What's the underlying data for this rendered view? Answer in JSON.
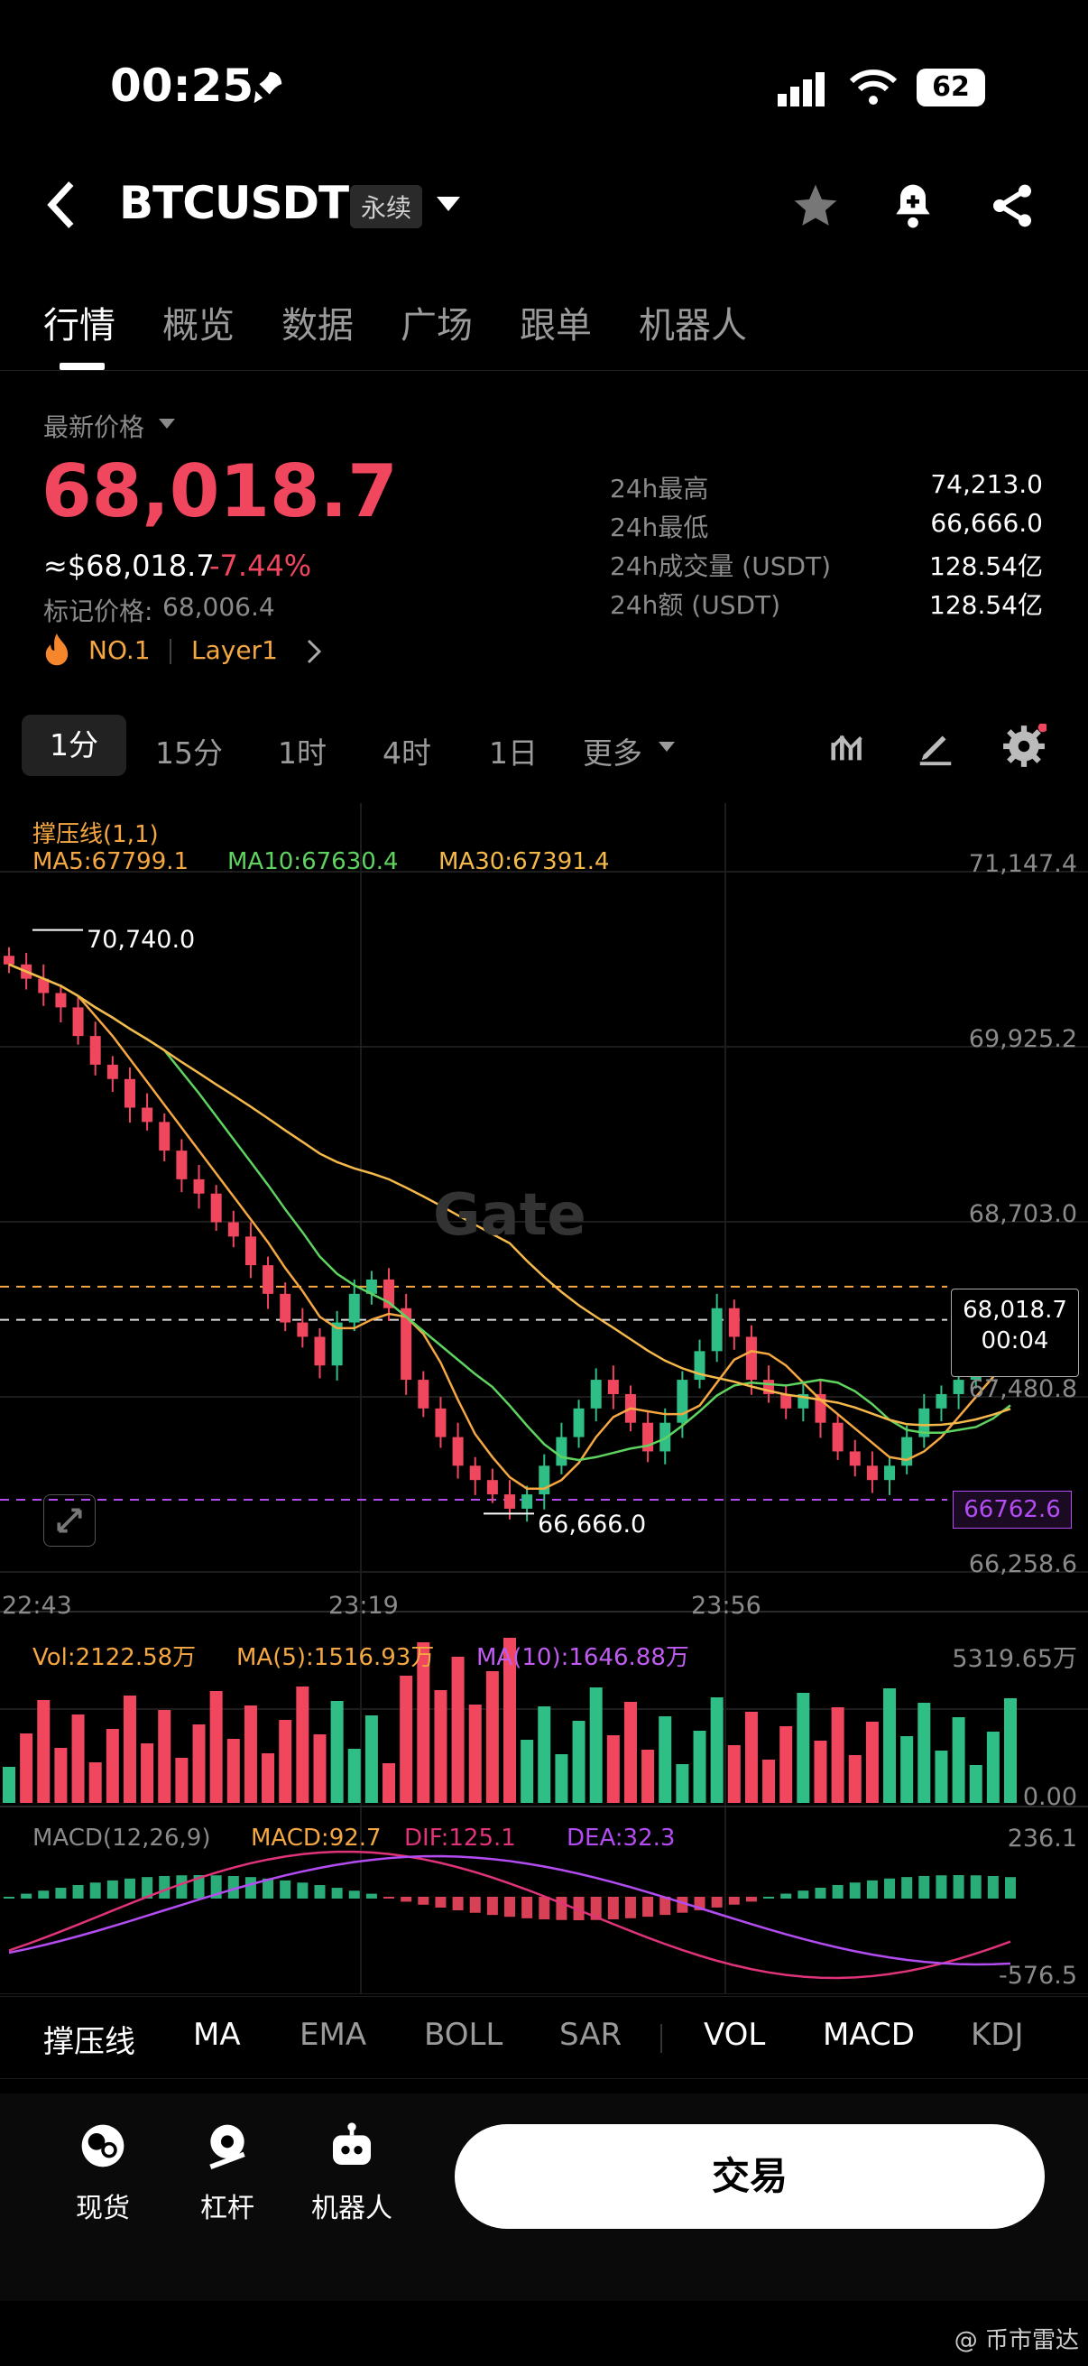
{
  "status_bar": {
    "time": "00:25",
    "battery": "62"
  },
  "header": {
    "symbol": "BTCUSDT",
    "contract_type": "永续"
  },
  "tabs": [
    "行情",
    "概览",
    "数据",
    "广场",
    "跟单",
    "机器人"
  ],
  "price": {
    "label": "最新价格",
    "last": "68,018.7",
    "usd": "≈$68,018.7",
    "change": "-7.44%",
    "mark_label": "标记价格:",
    "mark_value": "68,006.4",
    "rank": "NO.1",
    "category": "Layer1"
  },
  "stats": [
    {
      "label": "24h最高",
      "value": "74,213.0"
    },
    {
      "label": "24h最低",
      "value": "66,666.0"
    },
    {
      "label": "24h成交量 (USDT)",
      "value": "128.54亿"
    },
    {
      "label": "24h额 (USDT)",
      "value": "128.54亿"
    }
  ],
  "periods": [
    "1分",
    "15分",
    "1时",
    "4时",
    "1日",
    "更多"
  ],
  "chart": {
    "indicator_title": "撑压线(1,1)",
    "ma5": "MA5:67799.1",
    "ma10": "MA10:67630.4",
    "ma30": "MA30:67391.4",
    "y_ticks": [
      "71,147.4",
      "69,925.2",
      "68,703.0",
      "67,480.8",
      "66,258.6"
    ],
    "x_ticks": [
      "22:43",
      "23:19",
      "23:56"
    ],
    "high_marker": "70,740.0",
    "low_marker": "66,666.0",
    "current_price": "68,018.7",
    "countdown": "00:04",
    "support_level": "66762.6",
    "watermark": "Gate"
  },
  "volume": {
    "vol": "Vol:2122.58万",
    "ma5": "MA(5):1516.93万",
    "ma10": "MA(10):1646.88万",
    "max": "5319.65万",
    "min": "0.00"
  },
  "macd": {
    "title": "MACD(12,26,9)",
    "macd": "MACD:92.7",
    "dif": "DIF:125.1",
    "dea": "DEA:32.3",
    "max": "236.1",
    "min": "-576.5"
  },
  "indicator_tabs": [
    "撑压线",
    "MA",
    "EMA",
    "BOLL",
    "SAR",
    "VOL",
    "MACD",
    "KDJ"
  ],
  "bottom_nav": {
    "spot": "现货",
    "leverage": "杠杆",
    "bot": "机器人",
    "trade": "交易"
  },
  "footer_watermark": "@ 币市雷达",
  "colors": {
    "up": "#2fbf86",
    "down": "#f0475e",
    "ma5": "#f5a742",
    "ma10": "#5fd35f",
    "ma30": "#f5b94a",
    "dea": "#b34cf2",
    "dif": "#e0337a"
  },
  "chart_data": {
    "type": "candlestick",
    "x_range": [
      "22:43",
      "00:25"
    ],
    "ylim": [
      66258.6,
      71147.4
    ],
    "candles_close_approx": [
      70500,
      70400,
      70300,
      70200,
      70000,
      69800,
      69700,
      69500,
      69400,
      69200,
      69000,
      68900,
      68700,
      68600,
      68400,
      68200,
      68000,
      67900,
      67700,
      68000,
      68200,
      68300,
      68100,
      67600,
      67400,
      67200,
      67000,
      66900,
      66800,
      66700,
      66800,
      67000,
      67200,
      67400,
      67600,
      67500,
      67300,
      67100,
      67300,
      67600,
      67800,
      68100,
      67900,
      67600,
      67500,
      67400,
      67500,
      67300,
      67100,
      67000,
      66900,
      67000,
      67200,
      67400,
      67500,
      67600,
      67700,
      67900,
      68018.7
    ]
  }
}
